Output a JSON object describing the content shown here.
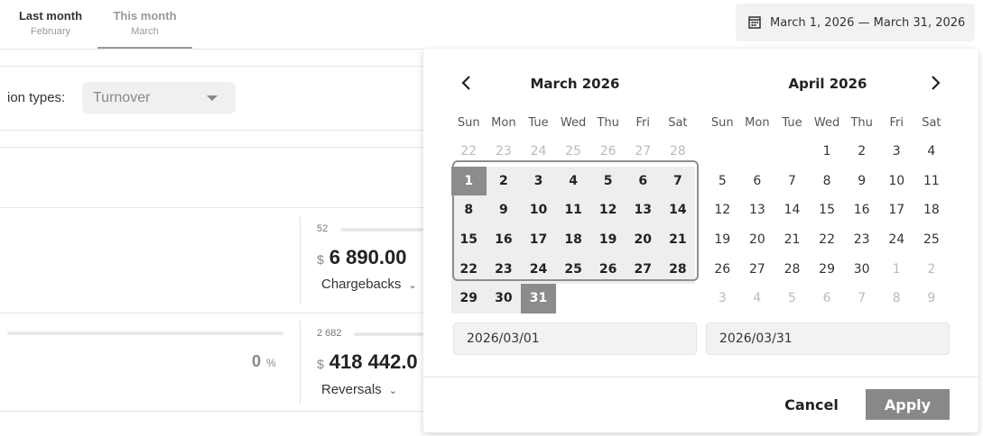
{
  "tabs": [
    {
      "label": "Last month",
      "sub": "February"
    },
    {
      "label": "This month",
      "sub": "March"
    }
  ],
  "date_range_button": {
    "label": "March 1, 2026 — March 31, 2026",
    "icon": "calendar-icon"
  },
  "filters": {
    "label": "ion types:",
    "select_value": "Turnover"
  },
  "metrics": [
    {
      "count": "52",
      "currency": "$",
      "amount": "6 890.00",
      "label": "Chargebacks"
    },
    {
      "count": "2 682",
      "currency": "$",
      "amount": "418 442.0",
      "label": "Reversals"
    }
  ],
  "left_percent": {
    "value": "0",
    "unit": "%"
  },
  "picker": {
    "weekdays": [
      "Sun",
      "Mon",
      "Tue",
      "Wed",
      "Thu",
      "Fri",
      "Sat"
    ],
    "months": [
      {
        "title": "March 2026",
        "weeks": [
          [
            "22",
            "23",
            "24",
            "25",
            "26",
            "27",
            "28"
          ],
          [
            "1",
            "2",
            "3",
            "4",
            "5",
            "6",
            "7"
          ],
          [
            "8",
            "9",
            "10",
            "11",
            "12",
            "13",
            "14"
          ],
          [
            "15",
            "16",
            "17",
            "18",
            "19",
            "20",
            "21"
          ],
          [
            "22",
            "23",
            "24",
            "25",
            "26",
            "27",
            "28"
          ],
          [
            "29",
            "30",
            "31",
            "",
            "",
            "",
            ""
          ]
        ]
      },
      {
        "title": "April 2026",
        "weeks": [
          [
            "",
            "",
            "",
            "1",
            "2",
            "3",
            "4"
          ],
          [
            "5",
            "6",
            "7",
            "8",
            "9",
            "10",
            "11"
          ],
          [
            "12",
            "13",
            "14",
            "15",
            "16",
            "17",
            "18"
          ],
          [
            "19",
            "20",
            "21",
            "22",
            "23",
            "24",
            "25"
          ],
          [
            "26",
            "27",
            "28",
            "29",
            "30",
            "1",
            "2"
          ],
          [
            "3",
            "4",
            "5",
            "6",
            "7",
            "8",
            "9"
          ]
        ]
      }
    ],
    "start_input": "2026/03/01",
    "end_input": "2026/03/31",
    "cancel_label": "Cancel",
    "apply_label": "Apply"
  }
}
